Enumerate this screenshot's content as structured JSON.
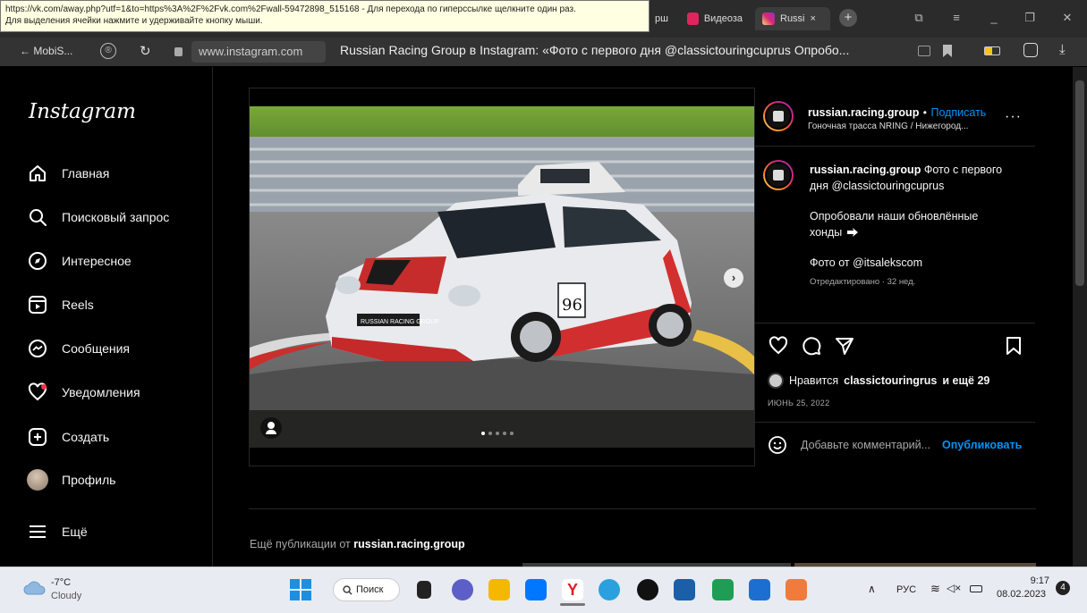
{
  "tooltip": {
    "line1": "https://vk.com/away.php?utf=1&to=https%3A%2F%2Fvk.com%2Fwall-59472898_515168 - Для перехода по гиперссылке щелкните один раз.",
    "line2": "Для выделения ячейки нажмите и удерживайте кнопку мыши."
  },
  "tabs": [
    {
      "label": "Видеоза",
      "color": "#e0245e"
    },
    {
      "label": "Russi",
      "close": "×",
      "color": "#d62976"
    }
  ],
  "tab_fragment": "рш",
  "address_bar": {
    "back_label": "MobiS...",
    "url": "www.instagram.com",
    "page_title": "Russian Racing Group в Instagram: «Фото с первого дня @classictouringcuprus Опробо..."
  },
  "sidebar": {
    "logo": "Instagram",
    "items": [
      {
        "label": "Главная",
        "icon": "home-icon"
      },
      {
        "label": "Поисковый запрос",
        "icon": "search-icon"
      },
      {
        "label": "Интересное",
        "icon": "compass-icon"
      },
      {
        "label": "Reels",
        "icon": "reels-icon"
      },
      {
        "label": "Сообщения",
        "icon": "messenger-icon"
      },
      {
        "label": "Уведомления",
        "icon": "heart-icon"
      },
      {
        "label": "Создать",
        "icon": "plus-square-icon"
      },
      {
        "label": "Профиль",
        "icon": "avatar"
      },
      {
        "label": "Ещё",
        "icon": "menu-icon"
      }
    ]
  },
  "post": {
    "username": "russian.racing.group",
    "follow_sep": "•",
    "follow": "Подписать",
    "location": "Гоночная трасса NRING / Нижегород...",
    "caption_user": "russian.racing.group",
    "caption_1": "Фото с первого",
    "caption_2": "дня @classictouringcuprus",
    "caption_3": "Опробовали наши обновлённые",
    "caption_4": "хонды",
    "caption_5": "Фото от @itsalekscom",
    "edited": "Отредактировано · 32 нед.",
    "likes_prefix": "Нравится",
    "likes_user": "classictouringrus",
    "likes_suffix": "и ещё 29",
    "date": "ИЮНЬ 25, 2022",
    "comment_placeholder": "Добавьте комментарий...",
    "publish": "Опубликовать",
    "car_number": "96",
    "car_text": "RUSSIAN RACING GROUP",
    "carousel_count": 5,
    "carousel_active": 1
  },
  "more_posts": {
    "prefix": "Ещё публикации от",
    "user": "russian.racing.group"
  },
  "taskbar": {
    "weather_temp": "-7°C",
    "weather_desc": "Cloudy",
    "search_label": "Поиск",
    "lang": "РУС",
    "time": "9:17",
    "date": "08.02.2023",
    "notif_count": "4"
  }
}
